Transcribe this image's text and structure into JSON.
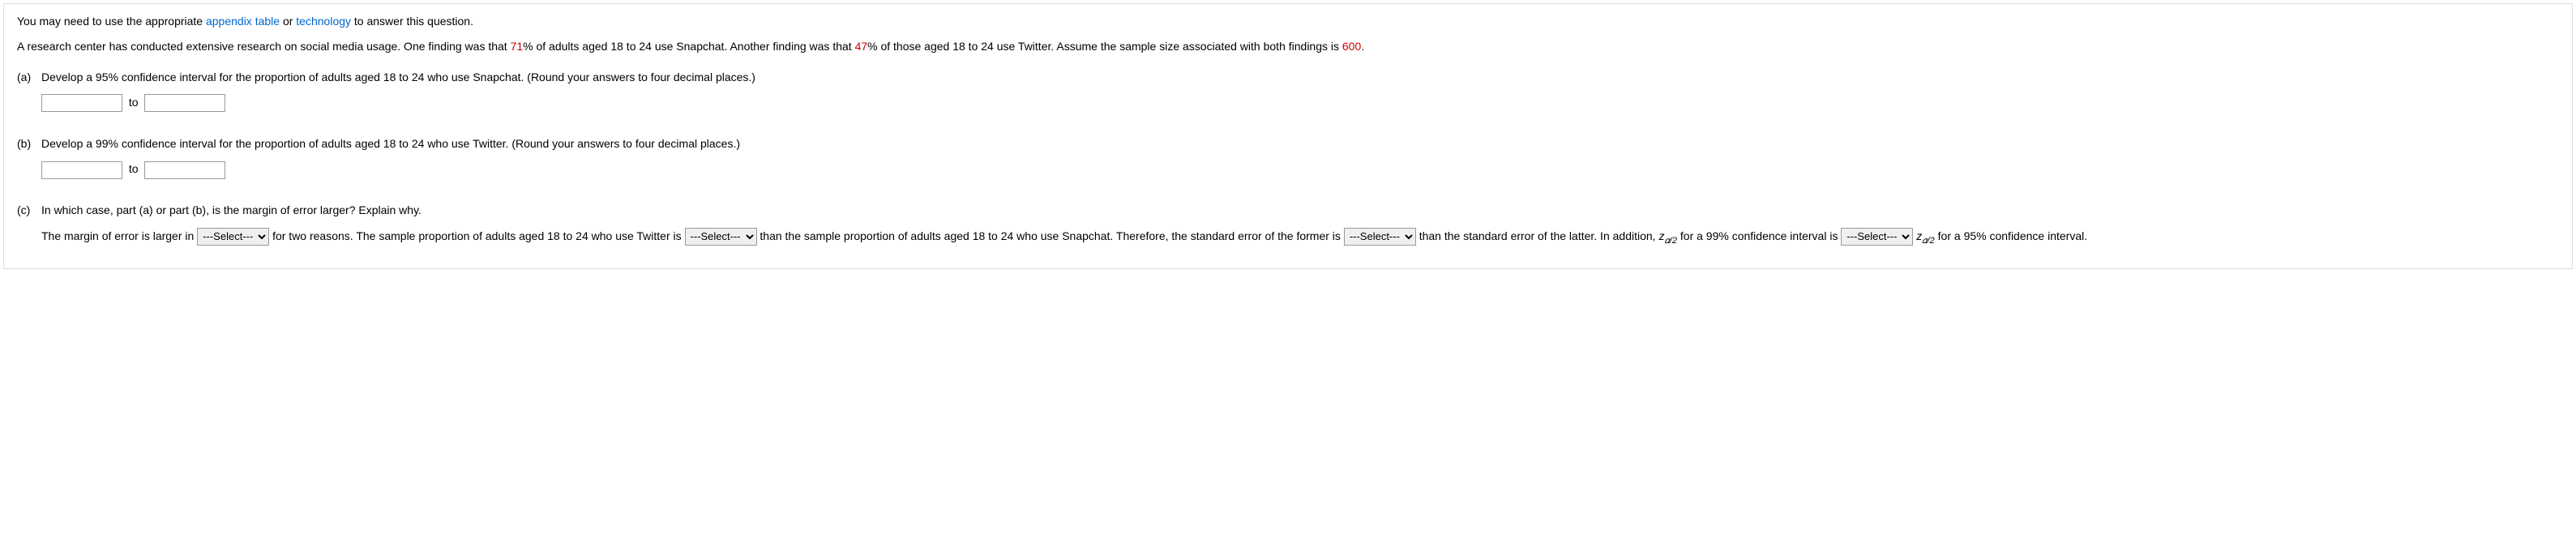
{
  "intro": {
    "pre": "You may need to use the appropriate ",
    "appendix_link": "appendix table",
    "mid": " or ",
    "technology_link": "technology",
    "post": " to answer this question."
  },
  "context": {
    "s1": "A research center has conducted extensive research on social media usage. One finding was that ",
    "pct1": "71",
    "s2": "% of adults aged 18 to 24 use Snapchat. Another finding was that ",
    "pct2": "47",
    "s3": "% of those aged 18 to 24 use Twitter. Assume the sample size associated with both findings is ",
    "n": "600",
    "s4": "."
  },
  "parts": {
    "a": {
      "label": "(a)",
      "text": "Develop a 95% confidence interval for the proportion of adults aged 18 to 24 who use Snapchat. (Round your answers to four decimal places.)",
      "to": "to"
    },
    "b": {
      "label": "(b)",
      "text": "Develop a 99% confidence interval for the proportion of adults aged 18 to 24 who use Twitter. (Round your answers to four decimal places.)",
      "to": "to"
    },
    "c": {
      "label": "(c)",
      "text": "In which case, part (a) or part (b), is the margin of error larger? Explain why.",
      "sent": {
        "p1": "The margin of error is larger in ",
        "p2": " for two reasons. The sample proportion of adults aged 18 to 24 who use Twitter is ",
        "p3": " than the sample proportion of adults aged 18 to 24 who use Snapchat. Therefore, the standard error of the former is ",
        "p4": " than the standard error of the latter. In addition, ",
        "zlabel1_main": "z",
        "zlabel1_sub": "𝛼/2",
        "p5": " for a 99% confidence interval is ",
        "zlabel2_main": "z",
        "zlabel2_sub": "𝛼/2",
        "p6": " for a 95% confidence interval."
      },
      "select_placeholder": "---Select---"
    }
  }
}
